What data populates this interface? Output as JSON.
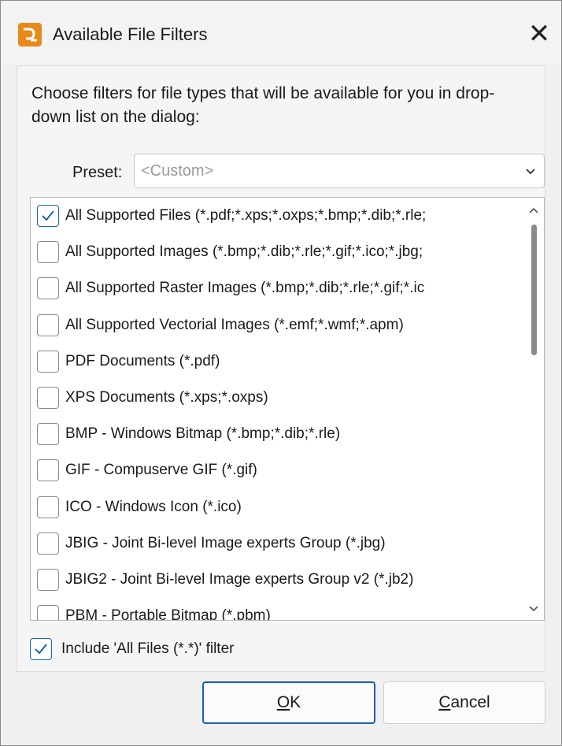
{
  "window": {
    "title": "Available File Filters",
    "close_glyph": "✕"
  },
  "content": {
    "description": "Choose filters for file types that will be available for you in drop-down list on the dialog:",
    "preset": {
      "label": "Preset:",
      "value": "<Custom>"
    },
    "filters": [
      {
        "label": "All Supported Files (*.pdf;*.xps;*.oxps;*.bmp;*.dib;*.rle;",
        "checked": true
      },
      {
        "label": "All Supported Images (*.bmp;*.dib;*.rle;*.gif;*.ico;*.jbg;",
        "checked": false
      },
      {
        "label": "All Supported Raster Images (*.bmp;*.dib;*.rle;*.gif;*.ic",
        "checked": false
      },
      {
        "label": "All Supported Vectorial Images (*.emf;*.wmf;*.apm)",
        "checked": false
      },
      {
        "label": "PDF Documents (*.pdf)",
        "checked": false
      },
      {
        "label": "XPS Documents (*.xps;*.oxps)",
        "checked": false
      },
      {
        "label": "BMP - Windows Bitmap (*.bmp;*.dib;*.rle)",
        "checked": false
      },
      {
        "label": "GIF - Compuserve GIF (*.gif)",
        "checked": false
      },
      {
        "label": "ICO - Windows Icon (*.ico)",
        "checked": false
      },
      {
        "label": "JBIG - Joint Bi-level Image experts Group (*.jbg)",
        "checked": false
      },
      {
        "label": "JBIG2 - Joint Bi-level Image experts Group v2 (*.jb2)",
        "checked": false
      },
      {
        "label": "PBM - Portable Bitmap (*.pbm)",
        "checked": false
      }
    ],
    "include_all_files": {
      "label": "Include 'All Files (*.*)' filter",
      "checked": true
    }
  },
  "buttons": {
    "ok_label": "OK",
    "cancel_label": "Cancel"
  },
  "icons": {
    "app": "app-logo-icon",
    "close": "close-icon",
    "dropdown": "chevron-down-icon",
    "check": "checkmark-icon",
    "scroll_up": "chevron-up-icon",
    "scroll_down": "chevron-down-icon"
  },
  "colors": {
    "accent": "#1a5fb4",
    "app_icon": "#e88a1a"
  }
}
